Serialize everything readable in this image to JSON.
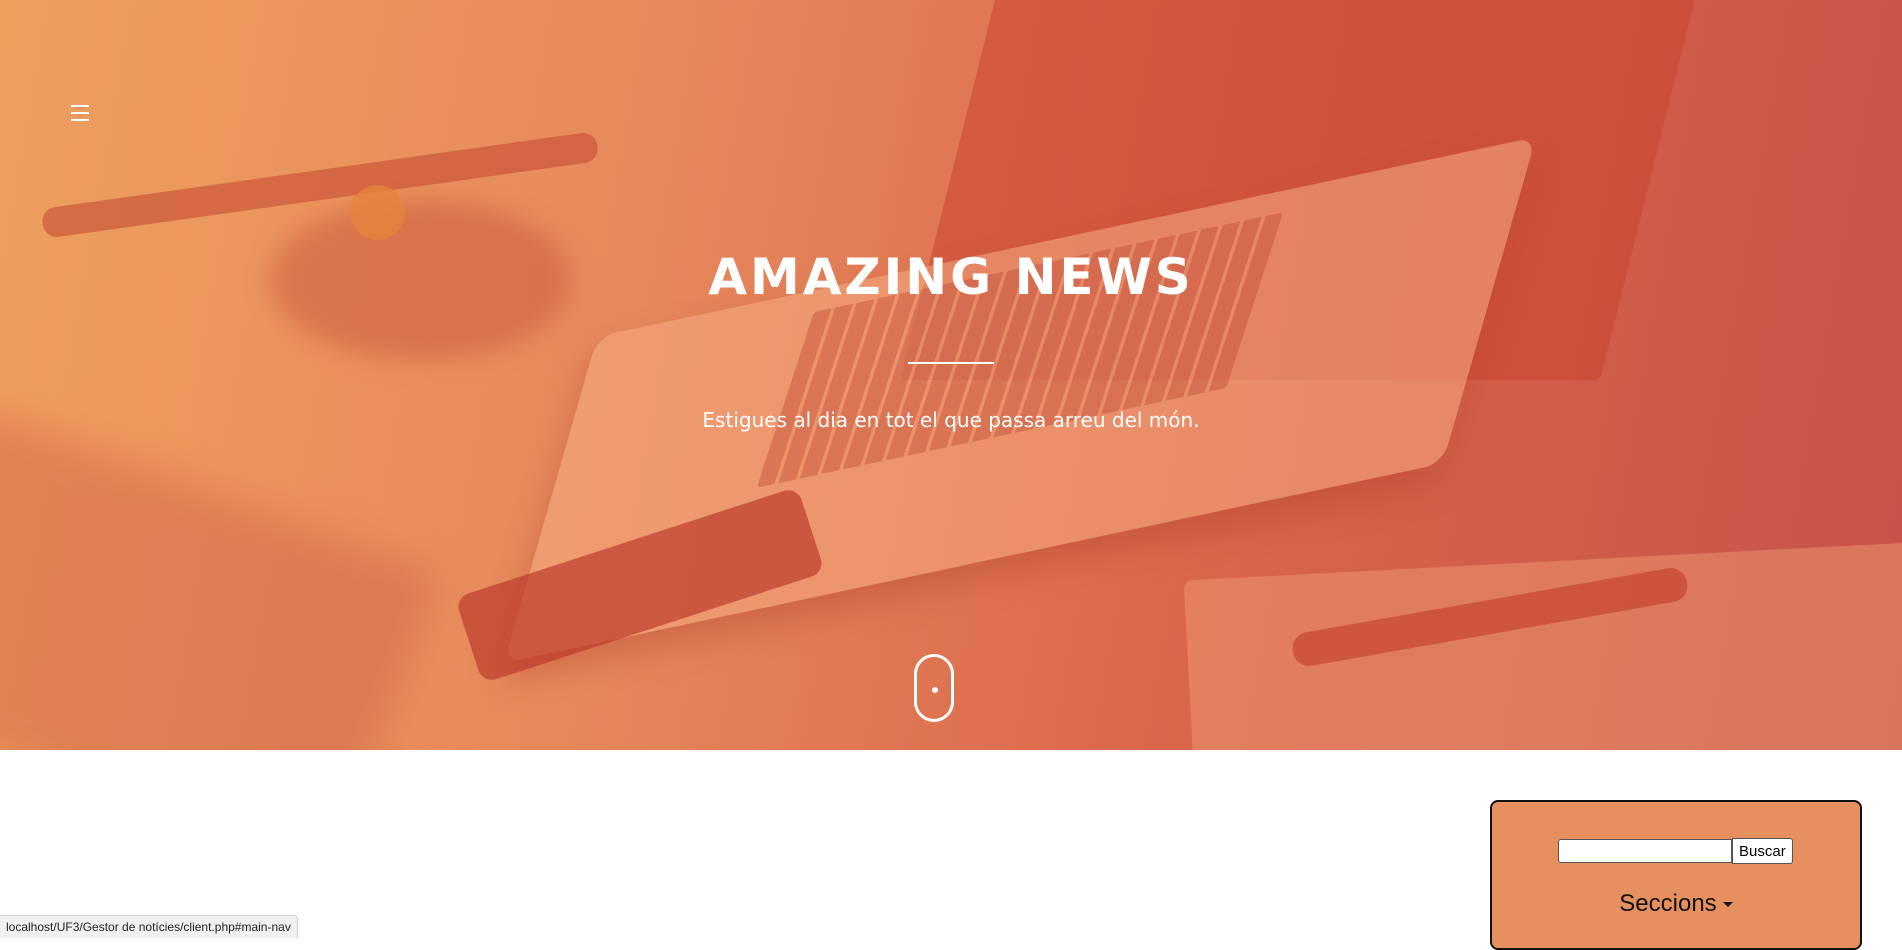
{
  "hero": {
    "title": "AMAZING NEWS",
    "subtitle": "Estigues al dia en tot el que passa arreu del món."
  },
  "nav": {
    "menu_icon": "hamburger-menu-icon"
  },
  "scroll_indicator": {
    "icon": "mouse-scroll-icon"
  },
  "sidebar": {
    "search": {
      "value": "",
      "placeholder": "",
      "button_label": "Buscar"
    },
    "sections_label": "Seccions",
    "sections_icon": "caret-down-icon"
  },
  "status_bar": {
    "url": "localhost/UF3/Gestor de notícies/client.php#main-nav"
  },
  "colors": {
    "hero_gradient_start": "#eea05f",
    "hero_gradient_end": "#c7524a",
    "sidebar_background": "#e69060",
    "text_on_hero": "#ffffff"
  }
}
